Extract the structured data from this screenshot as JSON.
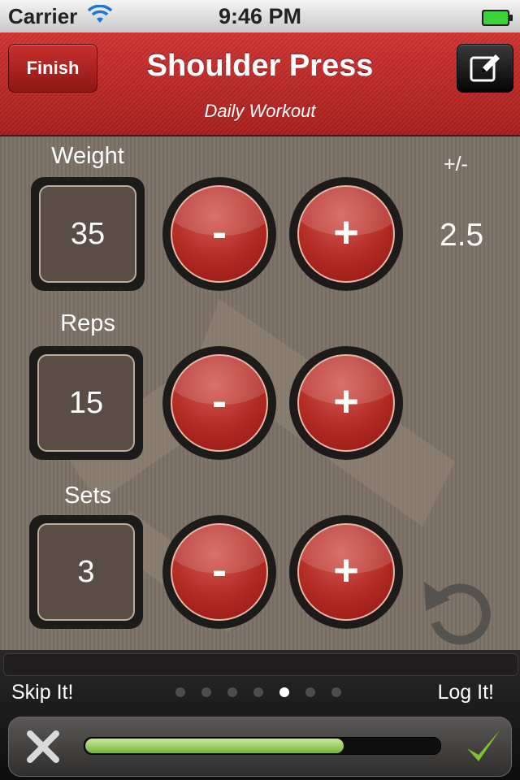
{
  "status_bar": {
    "carrier": "Carrier",
    "time": "9:46 PM"
  },
  "nav": {
    "title": "Shoulder Press",
    "subtitle": "Daily Workout",
    "finish_label": "Finish",
    "edit_icon": "compose-icon"
  },
  "weight": {
    "label": "Weight",
    "value": "35"
  },
  "reps": {
    "label": "Reps",
    "value": "15"
  },
  "sets": {
    "label": "Sets",
    "value": "3"
  },
  "buttons": {
    "minus": "-",
    "plus": "+"
  },
  "step": {
    "label": "+/-",
    "value": "2.5"
  },
  "bottom": {
    "skip_label": "Skip It!",
    "log_label": "Log It!",
    "page_count": 7,
    "active_page": 4,
    "slider_progress": 0.73,
    "skip_icon": "x-icon",
    "log_icon": "checkmark-icon"
  },
  "colors": {
    "accent_red": "#b22a24",
    "nav_red": "#c12a28",
    "progress_green": "#9ed265"
  }
}
